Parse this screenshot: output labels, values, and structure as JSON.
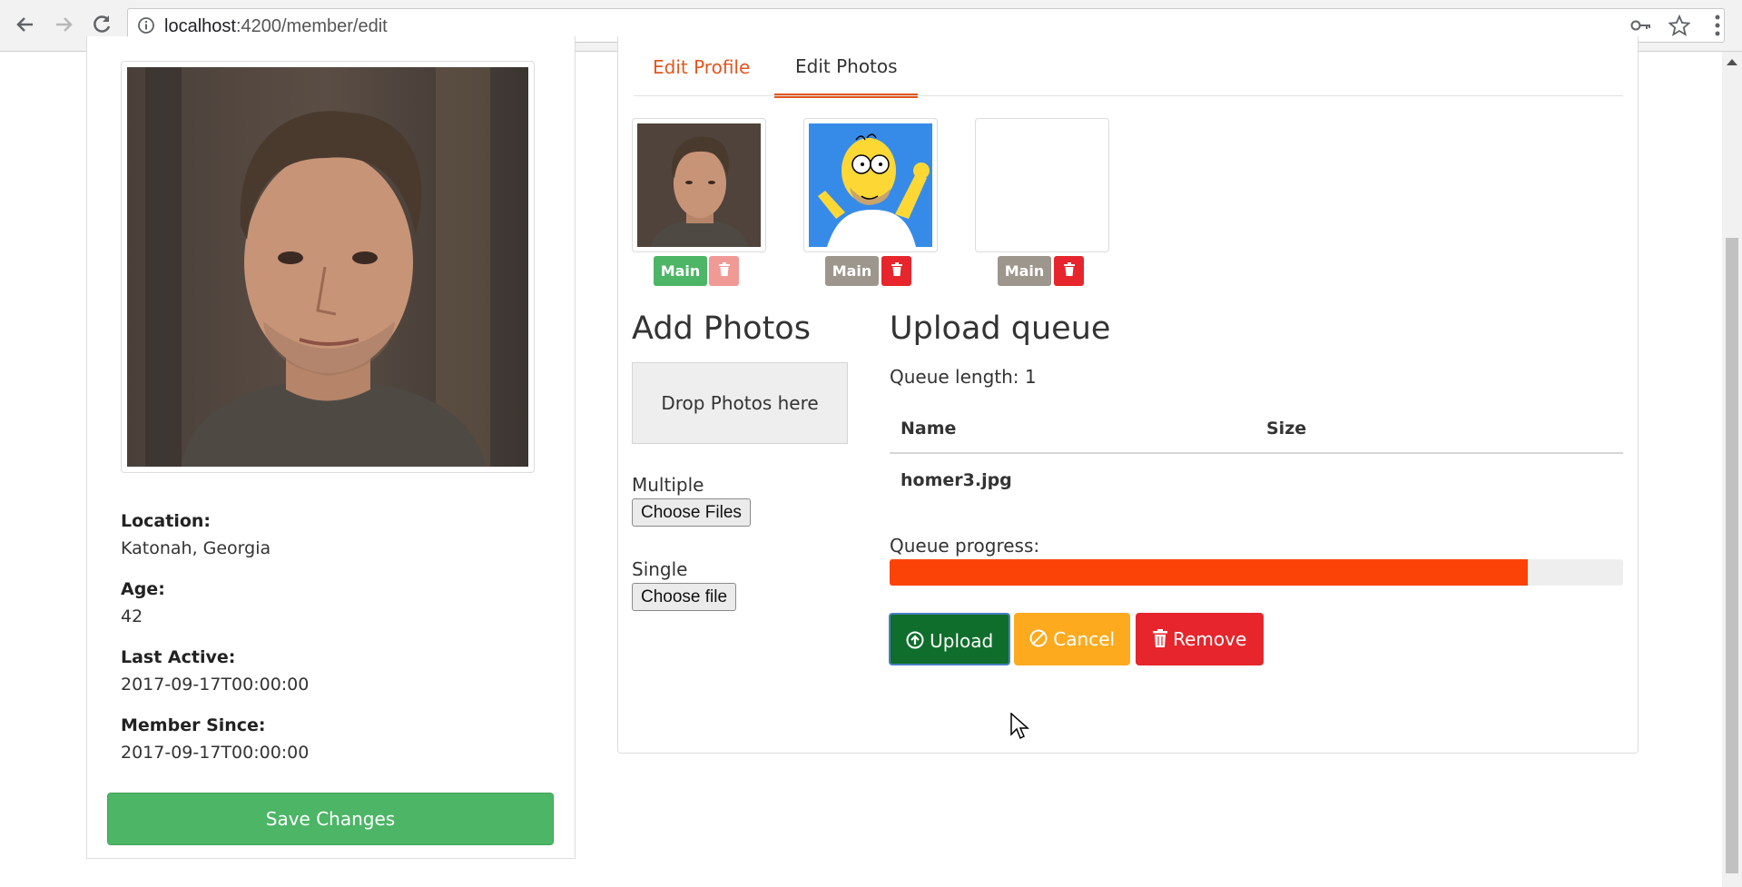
{
  "browser": {
    "url_host": "localhost",
    "url_path": ":4200/member/edit"
  },
  "member": {
    "location_label": "Location:",
    "location": "Katonah, Georgia",
    "age_label": "Age:",
    "age": "42",
    "last_active_label": "Last Active:",
    "last_active": "2017-09-17T00:00:00",
    "member_since_label": "Member Since:",
    "member_since": "2017-09-17T00:00:00",
    "save_label": "Save Changes"
  },
  "tabs": [
    {
      "label": "Edit Profile",
      "active": false
    },
    {
      "label": "Edit Photos",
      "active": true
    }
  ],
  "photos": [
    {
      "main_label": "Main",
      "is_main": true
    },
    {
      "main_label": "Main",
      "is_main": false
    },
    {
      "main_label": "Main",
      "is_main": false
    }
  ],
  "uploader": {
    "add_title": "Add Photos",
    "drop_text": "Drop Photos here",
    "multiple_label": "Multiple",
    "multiple_button": "Choose Files",
    "single_label": "Single",
    "single_button": "Choose file",
    "queue_title": "Upload queue",
    "queue_length": "Queue length: 1",
    "columns": [
      "Name",
      "Size"
    ],
    "rows": [
      {
        "name": "homer3.jpg",
        "size": ""
      }
    ],
    "progress_label": "Queue progress:",
    "progress_percent": 87,
    "upload_label": "Upload",
    "cancel_label": "Cancel",
    "remove_label": "Remove"
  },
  "colors": {
    "accent": "#e1561f",
    "success": "#4cb566",
    "upload": "#0f6e2b",
    "warning": "#fdaa1e",
    "danger": "#e6262c",
    "progress": "#fc4307"
  }
}
